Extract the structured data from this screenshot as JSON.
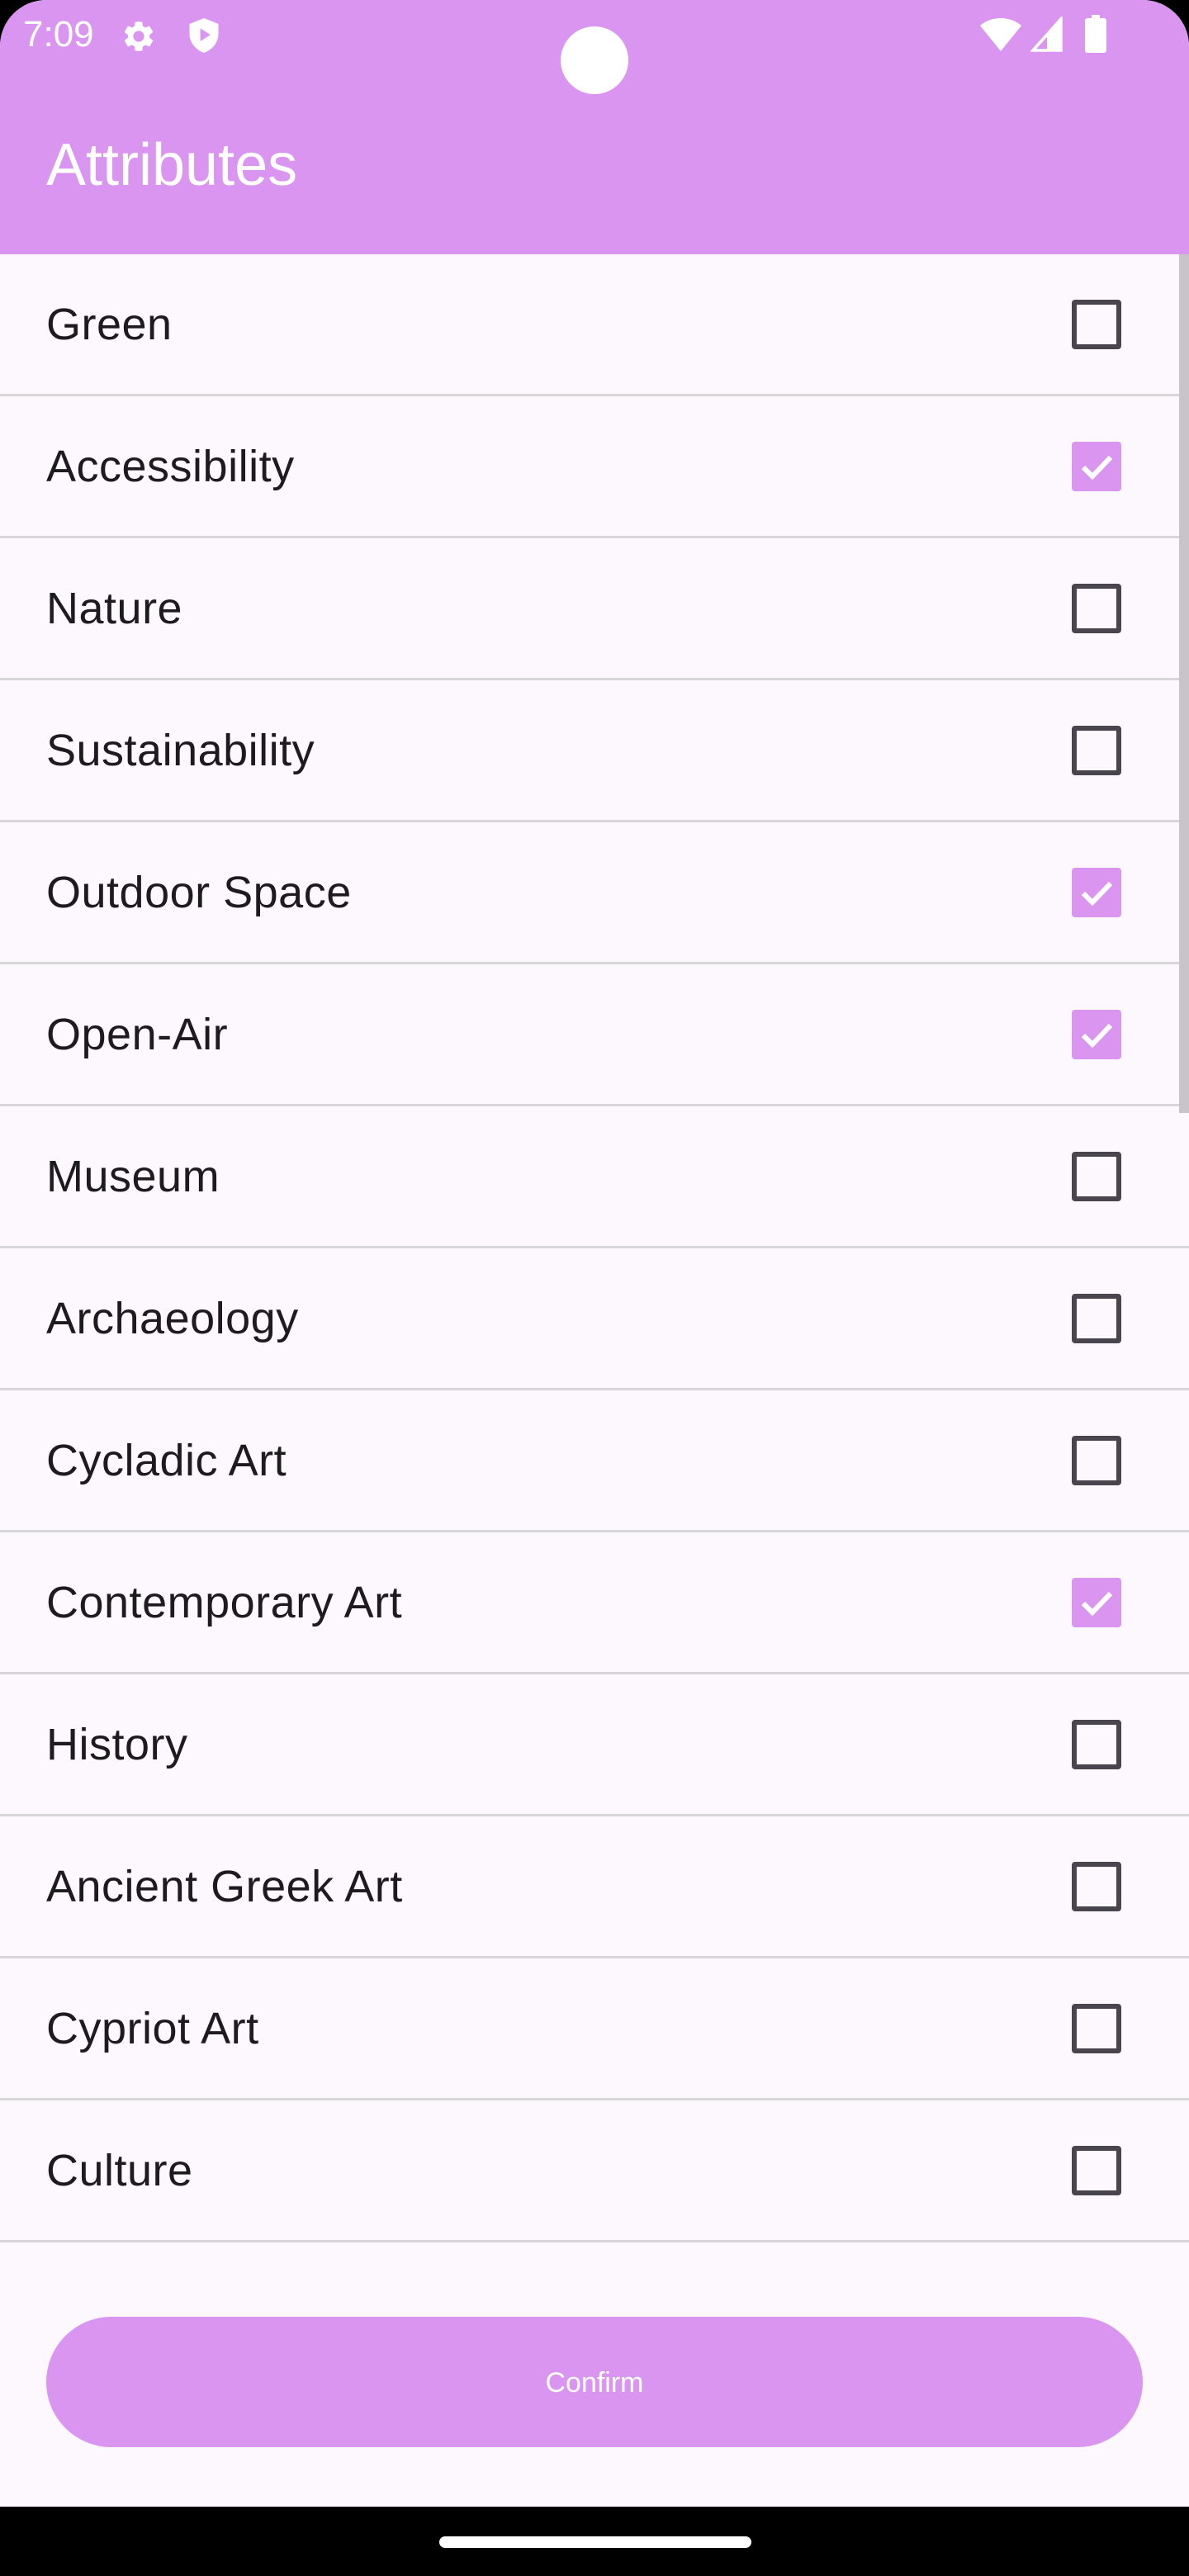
{
  "status_bar": {
    "time": "7:09",
    "icons": [
      "gear-icon",
      "shield-play-icon",
      "wifi-icon",
      "cellular-signal-icon",
      "battery-icon"
    ]
  },
  "app_bar": {
    "title": "Attributes",
    "color": "#da95f0"
  },
  "attributes": [
    {
      "label": "Green",
      "checked": false
    },
    {
      "label": "Accessibility",
      "checked": true
    },
    {
      "label": "Nature",
      "checked": false
    },
    {
      "label": "Sustainability",
      "checked": false
    },
    {
      "label": "Outdoor Space",
      "checked": true
    },
    {
      "label": "Open-Air",
      "checked": true
    },
    {
      "label": "Museum",
      "checked": false
    },
    {
      "label": "Archaeology",
      "checked": false
    },
    {
      "label": "Cycladic Art",
      "checked": false
    },
    {
      "label": "Contemporary Art",
      "checked": true
    },
    {
      "label": "History",
      "checked": false
    },
    {
      "label": "Ancient Greek Art",
      "checked": false
    },
    {
      "label": "Cypriot Art",
      "checked": false
    },
    {
      "label": "Culture",
      "checked": false
    }
  ],
  "confirm": {
    "label": "Confirm"
  },
  "colors": {
    "accent": "#da95f0",
    "background": "#fdf8fd",
    "text": "#1d1b1e",
    "divider": "#d9d6da"
  }
}
